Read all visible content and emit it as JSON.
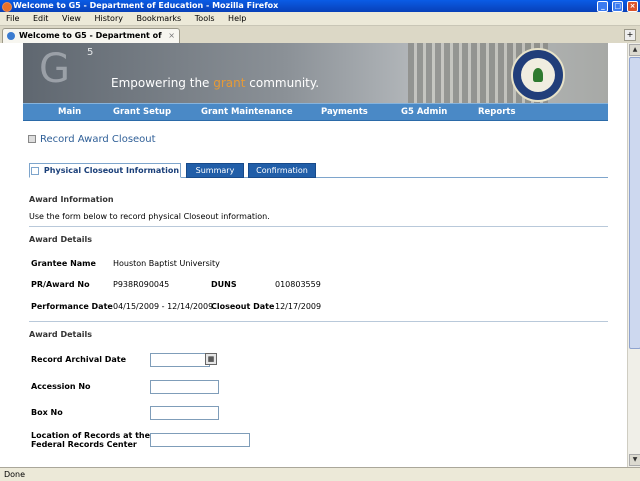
{
  "window": {
    "title": "Welcome to G5 - Department of Education - Mozilla Firefox",
    "controls": [
      "_",
      "□",
      "×"
    ]
  },
  "menu": [
    "File",
    "Edit",
    "View",
    "History",
    "Bookmarks",
    "Tools",
    "Help"
  ],
  "browser_tab": {
    "label": "Welcome to G5 - Department of Educ...",
    "close": "×",
    "new_tab": "+"
  },
  "banner": {
    "logo_letter": "G",
    "logo_sup": "5",
    "tagline_pre": "Empowering the ",
    "tagline_accent": "grant",
    "tagline_post": " community."
  },
  "nav": [
    "Main",
    "Grant Setup",
    "Grant Maintenance",
    "Payments",
    "G5 Admin",
    "Reports"
  ],
  "page_title": "Record Award Closeout",
  "tabs": {
    "active": "Physical Closeout Information",
    "summary": "Summary",
    "confirmation": "Confirmation"
  },
  "award_information": {
    "heading": "Award Information",
    "description": "Use the form below to record physical Closeout information."
  },
  "award_details": {
    "heading": "Award Details",
    "grantee_label": "Grantee Name",
    "grantee_value": "Houston Baptist University",
    "pr_label": "PR/Award No",
    "pr_value": "P938R090045",
    "duns_label": "DUNS",
    "duns_value": "010803559",
    "performance_label": "Performance Date",
    "performance_value": "04/15/2009 - 12/14/2009",
    "closeout_label": "Closeout Date",
    "closeout_value": "12/17/2009"
  },
  "form": {
    "heading": "Award Details",
    "archival_label": "Record Archival Date",
    "archival_value": "",
    "accession_label": "Accession No",
    "accession_value": "",
    "box_label": "Box No",
    "box_value": "",
    "location_label_1": "Location of Records at the",
    "location_label_2": "Federal Records Center",
    "location_value": ""
  },
  "status": "Done",
  "colors": {
    "nav_bg": "#4a89c6",
    "tab_active_text": "#1a3f79",
    "tab_inactive_bg": "#215ea8",
    "title_blue": "#2f5f97",
    "accent_orange": "#e59a37"
  }
}
